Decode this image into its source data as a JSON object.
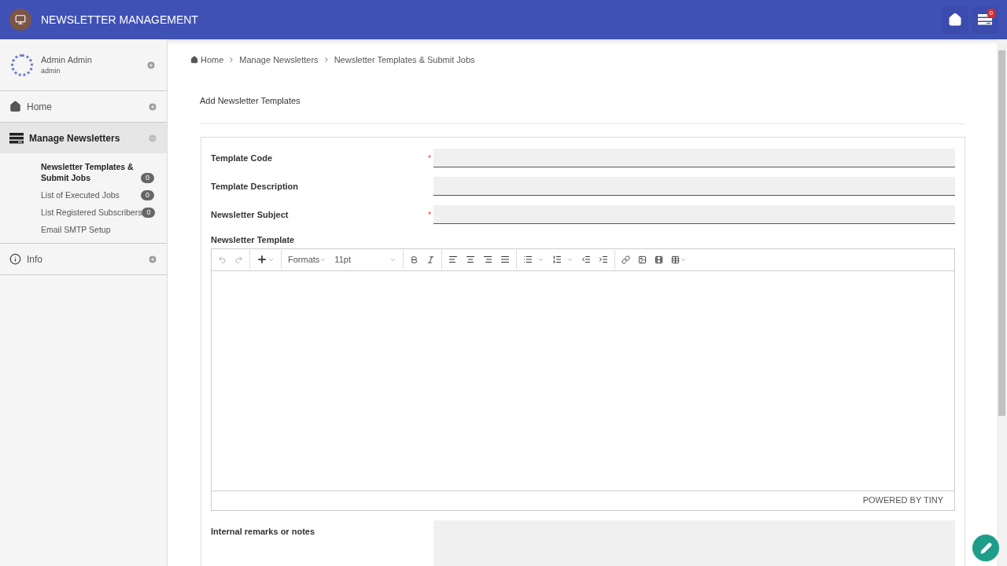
{
  "header": {
    "title": "NEWSLETTER MANAGEMENT",
    "notification_count": "0"
  },
  "user": {
    "name": "Admin Admin",
    "login": "admin"
  },
  "nav": [
    {
      "label": "Home",
      "expanded": false,
      "selected": false
    },
    {
      "label": "Manage Newsletters",
      "expanded": true,
      "selected": true,
      "children": [
        {
          "label": "Newsletter Templates & Submit Jobs",
          "badge": "0",
          "selected": true
        },
        {
          "label": "List of Executed Jobs",
          "badge": "0",
          "selected": false
        },
        {
          "label": "List Registered Subscribers",
          "badge": "0",
          "selected": false
        },
        {
          "label": "Email SMTP Setup",
          "selected": false
        }
      ]
    },
    {
      "label": "Info",
      "expanded": false,
      "selected": false
    }
  ],
  "breadcrumb": [
    "Home",
    "Manage Newsletters",
    "Newsletter Templates & Submit Jobs"
  ],
  "page_title": "Add Newsletter Templates",
  "fields": [
    {
      "label": "Template Code",
      "required_marker": "*"
    },
    {
      "label": "Template Description"
    },
    {
      "label": "Newsletter Subject",
      "required_marker": "*"
    }
  ],
  "editor": {
    "label": "Newsletter Template",
    "formats": "Formats",
    "font_size": "11pt",
    "status": "POWERED BY TINY"
  },
  "remarks": {
    "label": "Internal remarks or notes"
  }
}
